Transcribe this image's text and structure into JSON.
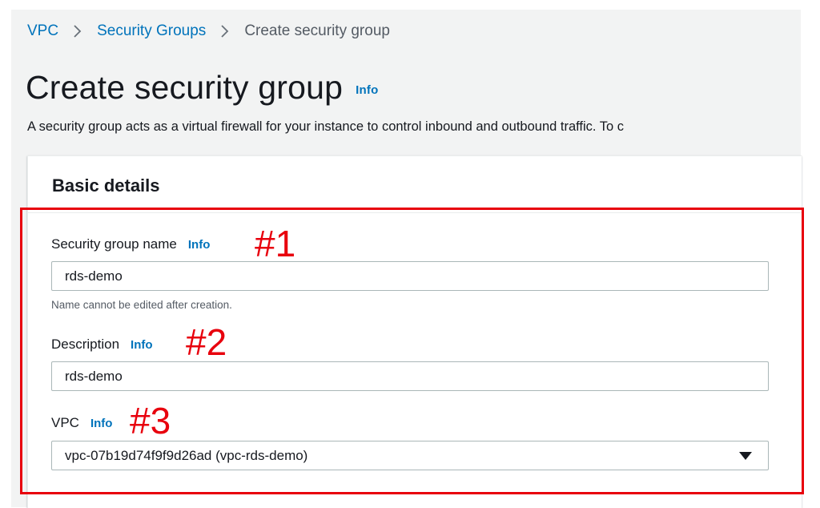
{
  "breadcrumb": {
    "items": [
      "VPC",
      "Security Groups",
      "Create security group"
    ]
  },
  "header": {
    "title": "Create security group",
    "info": "Info",
    "description": "A security group acts as a virtual firewall for your instance to control inbound and outbound traffic. To c"
  },
  "basic_details": {
    "heading": "Basic details",
    "name_field": {
      "label": "Security group name",
      "info": "Info",
      "value": "rds-demo",
      "constraint": "Name cannot be edited after creation.",
      "annotation": "#1"
    },
    "description_field": {
      "label": "Description",
      "info": "Info",
      "value": "rds-demo",
      "annotation": "#2"
    },
    "vpc_field": {
      "label": "VPC",
      "info": "Info",
      "selected": "vpc-07b19d74f9f9d26ad (vpc-rds-demo)",
      "annotation": "#3"
    }
  },
  "icons": {
    "breadcrumb_separator": "chevron-right-icon",
    "select_caret": "caret-down-icon"
  },
  "colors": {
    "link": "#0073bb",
    "annotation": "#e8000d",
    "page_background": "#f2f3f3"
  }
}
